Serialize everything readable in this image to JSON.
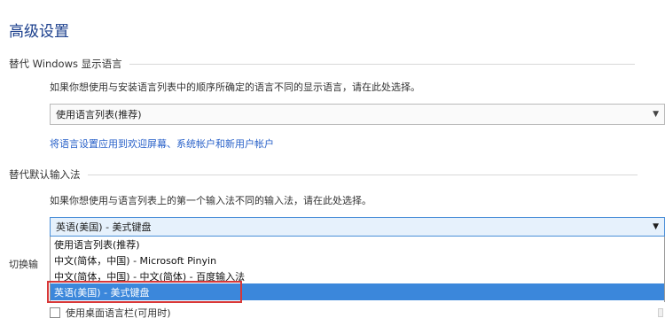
{
  "page": {
    "title": "高级设置"
  },
  "display_language": {
    "header": "替代 Windows 显示语言",
    "description": "如果你想使用与安装语言列表中的顺序所确定的语言不同的显示语言，请在此处选择。",
    "select_value": "使用语言列表(推荐)",
    "link": "将语言设置应用到欢迎屏幕、系统帐户和新用户帐户"
  },
  "input_method": {
    "header": "替代默认输入法",
    "description": "如果你想使用与语言列表上的第一个输入法不同的输入法，请在此处选择。",
    "select_value": "英语(美国) - 美式键盘",
    "options": [
      "使用语言列表(推荐)",
      "中文(简体，中国) - Microsoft Pinyin",
      "中文(简体，中国) - 中文(简体) - 百度输入法",
      "英语(美国) - 美式键盘"
    ],
    "selected_index": 3
  },
  "switch_section": {
    "label": "切换输"
  },
  "checkbox": {
    "label": "使用桌面语言栏(可用时)",
    "checked": false
  },
  "colors": {
    "title": "#1a3e8c",
    "link": "#2a62c9",
    "selection": "#3b87db",
    "highlight_border": "#d83838"
  }
}
